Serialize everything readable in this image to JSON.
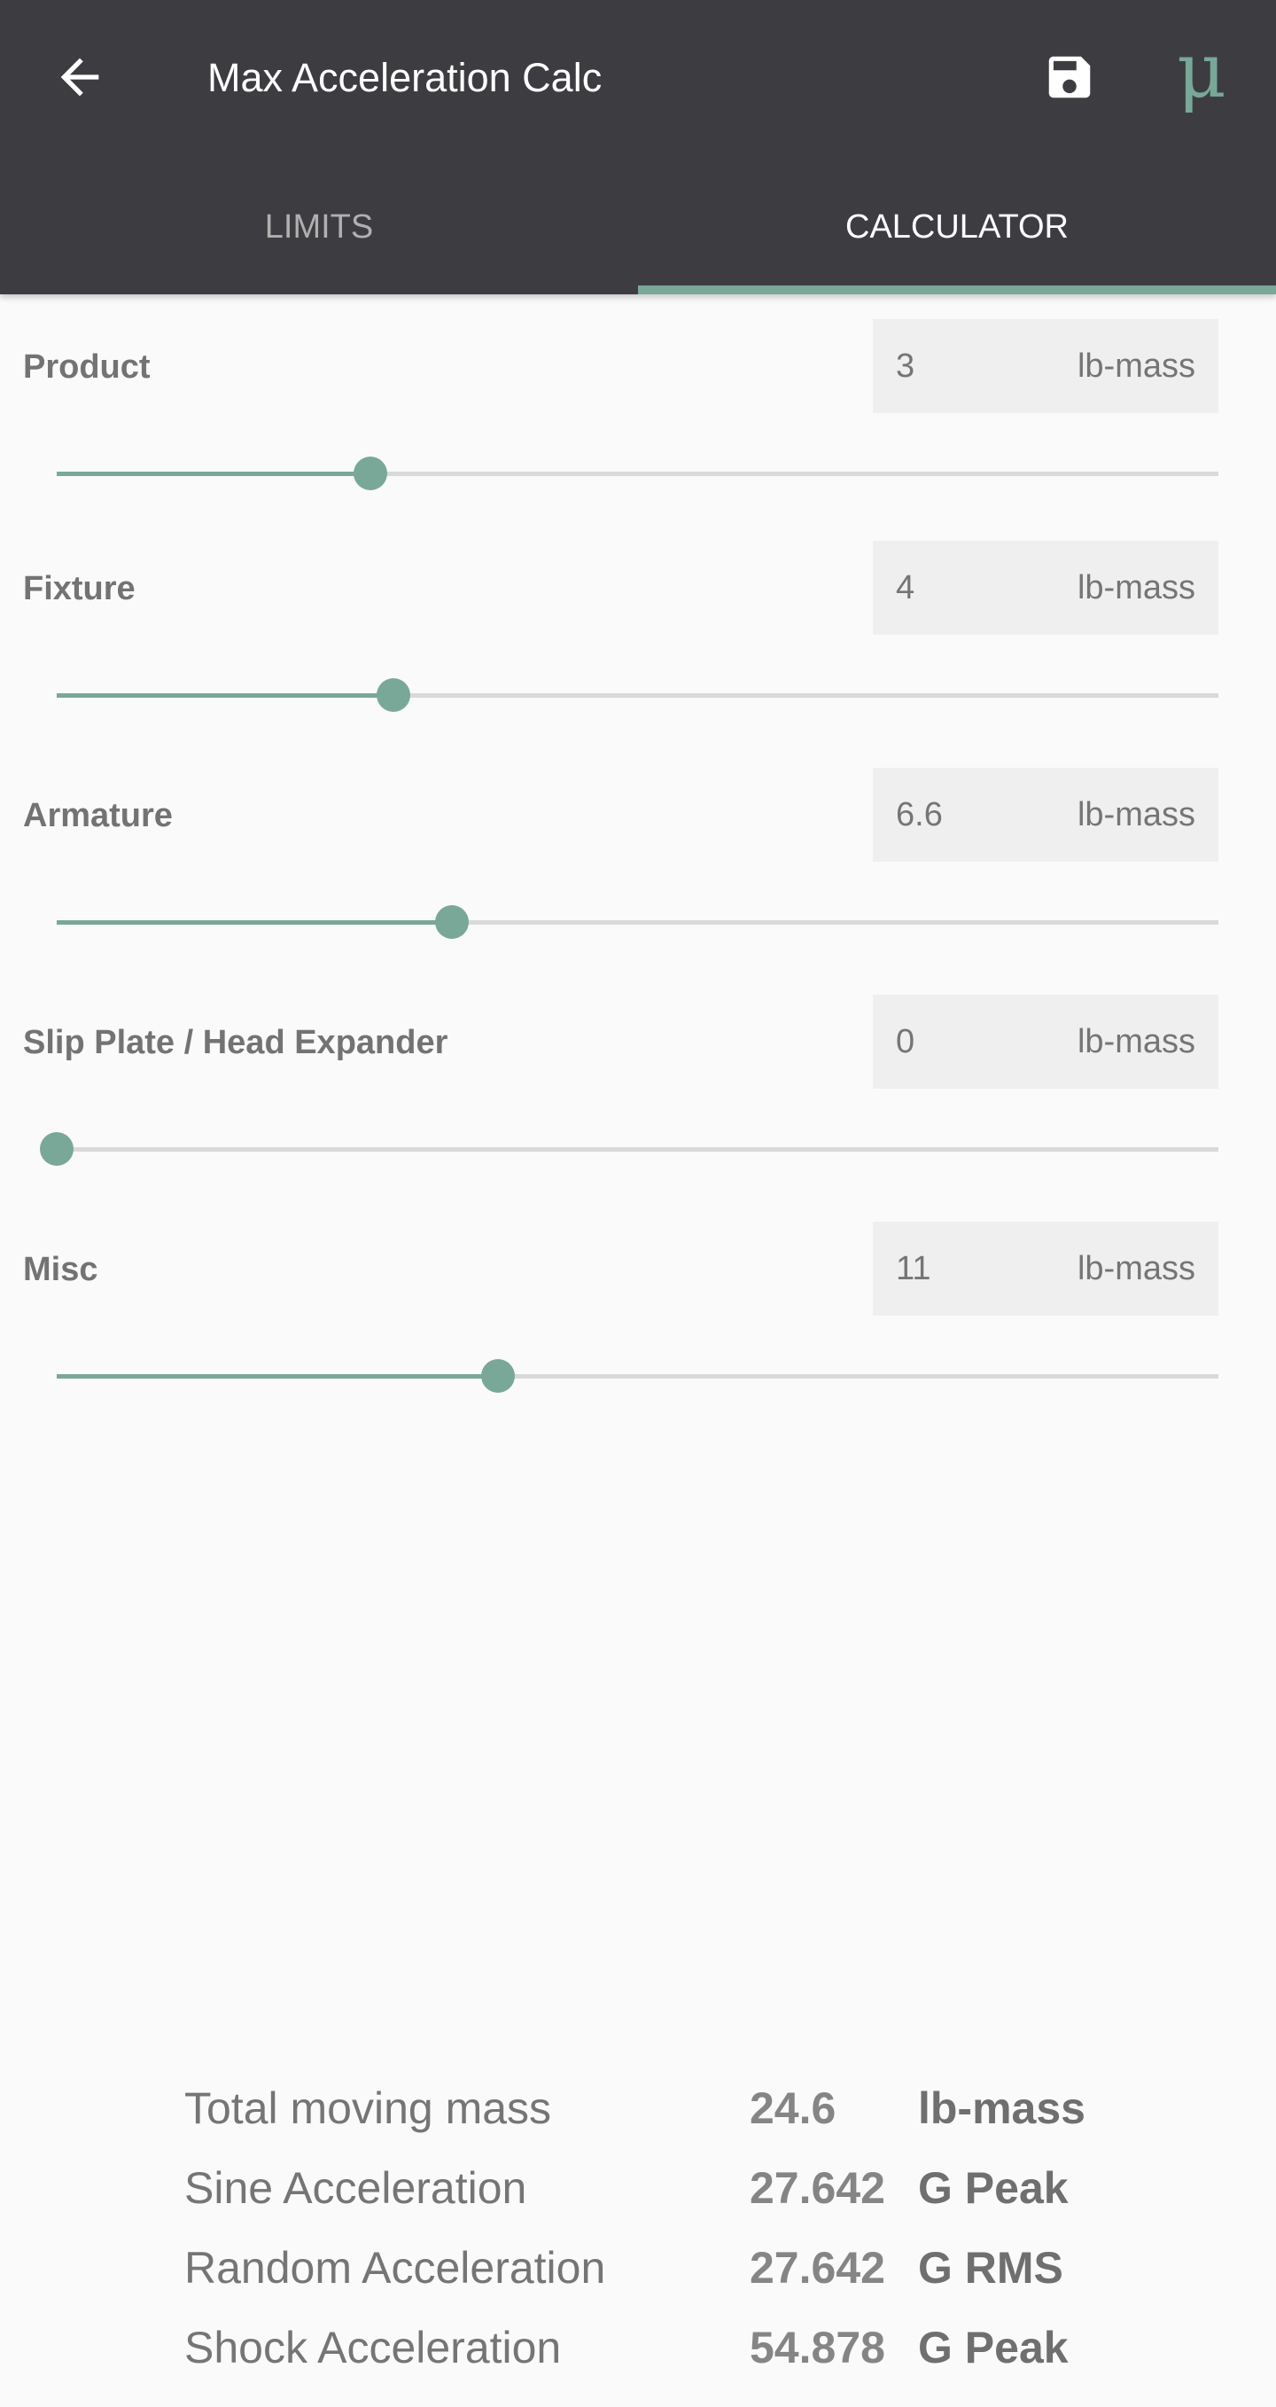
{
  "appbar": {
    "title": "Max Acceleration Calc",
    "back_icon": "arrow-left-icon",
    "save_icon": "save-icon",
    "logo_glyph": "μ"
  },
  "tabs": [
    {
      "label": "LIMITS",
      "selected": false
    },
    {
      "label": "CALCULATOR",
      "selected": true
    }
  ],
  "colors": {
    "accent": "#79a898",
    "appbar": "#3d3d41",
    "background": "#fafafa"
  },
  "inputs": [
    {
      "label": "Product",
      "value": "3",
      "unit": "lb-mass",
      "slider_fraction": 0.27
    },
    {
      "label": "Fixture",
      "value": "4",
      "unit": "lb-mass",
      "slider_fraction": 0.29
    },
    {
      "label": "Armature",
      "value": "6.6",
      "unit": "lb-mass",
      "slider_fraction": 0.34
    },
    {
      "label": "Slip Plate / Head Expander",
      "value": "0",
      "unit": "lb-mass",
      "slider_fraction": 0.0
    },
    {
      "label": "Misc",
      "value": "11",
      "unit": "lb-mass",
      "slider_fraction": 0.38
    }
  ],
  "results": [
    {
      "label": "Total moving mass",
      "value": "24.6",
      "unit": "lb-mass"
    },
    {
      "label": "Sine Acceleration",
      "value": "27.642",
      "unit": "G Peak"
    },
    {
      "label": "Random Acceleration",
      "value": "27.642",
      "unit": "G RMS"
    },
    {
      "label": "Shock Acceleration",
      "value": "54.878",
      "unit": "G Peak"
    }
  ]
}
